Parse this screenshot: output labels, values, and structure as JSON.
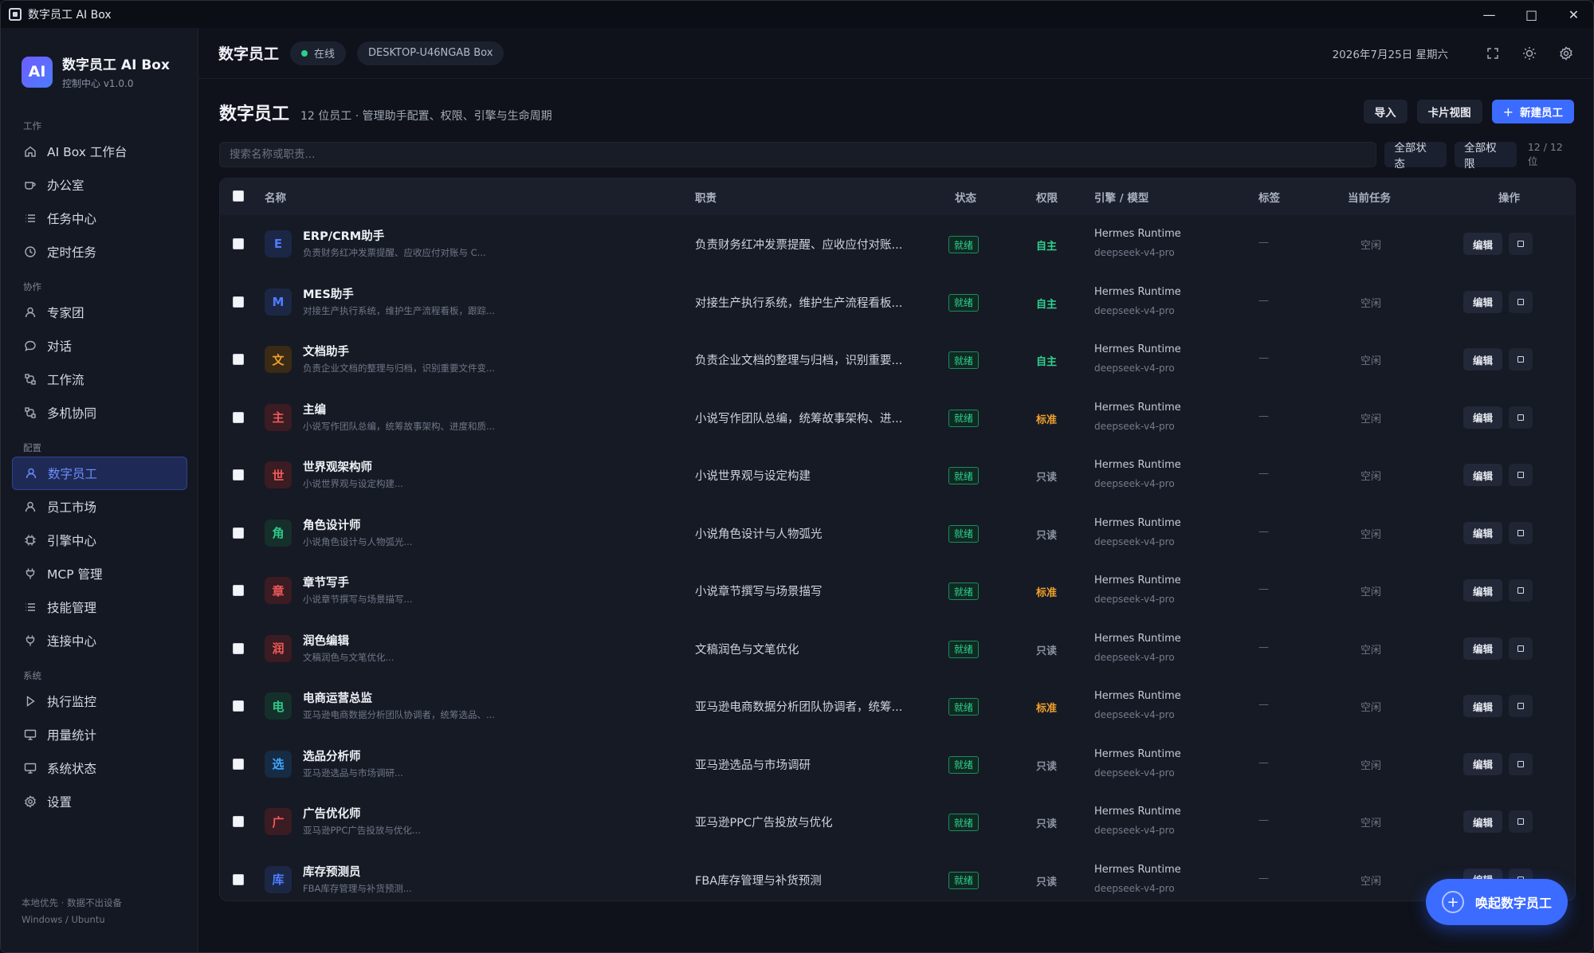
{
  "window": {
    "title": "数字员工 AI Box",
    "controls": [
      "minimize",
      "maximize",
      "close"
    ]
  },
  "brand": {
    "logo": "AI",
    "name": "数字员工 AI Box",
    "version": "控制中心 v1.0.0"
  },
  "sidebar": {
    "sections": [
      {
        "label": "工作",
        "items": [
          {
            "label": "AI Box 工作台",
            "icon": "home-icon"
          },
          {
            "label": "办公室",
            "icon": "coffee-icon"
          },
          {
            "label": "任务中心",
            "icon": "list-icon"
          },
          {
            "label": "定时任务",
            "icon": "clock-icon"
          }
        ]
      },
      {
        "label": "协作",
        "items": [
          {
            "label": "专家团",
            "icon": "user-icon"
          },
          {
            "label": "对话",
            "icon": "chat-icon"
          },
          {
            "label": "工作流",
            "icon": "workflow-icon"
          },
          {
            "label": "多机协同",
            "icon": "workflow-icon"
          }
        ]
      },
      {
        "label": "配置",
        "items": [
          {
            "label": "数字员工",
            "icon": "user-icon",
            "active": true
          },
          {
            "label": "员工市场",
            "icon": "user-icon"
          },
          {
            "label": "引擎中心",
            "icon": "cpu-icon"
          },
          {
            "label": "MCP 管理",
            "icon": "plug-icon"
          },
          {
            "label": "技能管理",
            "icon": "list-icon"
          },
          {
            "label": "连接中心",
            "icon": "plug-icon"
          }
        ]
      },
      {
        "label": "系统",
        "items": [
          {
            "label": "执行监控",
            "icon": "play-icon"
          },
          {
            "label": "用量统计",
            "icon": "monitor-icon"
          },
          {
            "label": "系统状态",
            "icon": "monitor-icon"
          },
          {
            "label": "设置",
            "icon": "gear-icon"
          }
        ]
      }
    ],
    "footer": [
      "本地优先 · 数据不出设备",
      "Windows / Ubuntu"
    ]
  },
  "topbar": {
    "title": "数字员工",
    "status": "在线",
    "device": "DESKTOP-U46NGAB Box",
    "date": "2026年7月25日 星期六"
  },
  "page": {
    "heading": "数字员工",
    "subtitle": "12 位员工 · 管理助手配置、权限、引擎与生命周期",
    "import_label": "导入",
    "card_view_label": "卡片视图",
    "new_label": "新建员工"
  },
  "filter": {
    "search_placeholder": "搜索名称或职责...",
    "status_filter": "全部状态",
    "perm_filter": "全部权限",
    "count": "12 / 12 位"
  },
  "table": {
    "columns": [
      "名称",
      "职责",
      "状态",
      "权限",
      "引擎 / 模型",
      "标签",
      "当前任务",
      "操作"
    ],
    "rows": [
      {
        "avatar": "E",
        "avatar_color": "#4f7cff",
        "avatar_bg": "#1c2746",
        "name": "ERP/CRM助手",
        "desc": "负责财务红冲发票提醒、应收应付对账与 C...",
        "duty": "负责财务红冲发票提醒、应收应付对账...",
        "status": "就绪",
        "perm": "自主",
        "perm_color": "#2fd18f",
        "engine": "Hermes Runtime",
        "model": "deepseek-v4-pro",
        "tag": "—",
        "task": "空闲",
        "edit": "编辑"
      },
      {
        "avatar": "M",
        "avatar_color": "#4f7cff",
        "avatar_bg": "#1c2746",
        "name": "MES助手",
        "desc": "对接生产执行系统，维护生产流程看板，跟踪...",
        "duty": "对接生产执行系统，维护生产流程看板...",
        "status": "就绪",
        "perm": "自主",
        "perm_color": "#2fd18f",
        "engine": "Hermes Runtime",
        "model": "deepseek-v4-pro",
        "tag": "—",
        "task": "空闲",
        "edit": "编辑"
      },
      {
        "avatar": "文",
        "avatar_color": "#f0a12c",
        "avatar_bg": "#3a2a16",
        "name": "文档助手",
        "desc": "负责企业文档的整理与归档，识别重要文件变...",
        "duty": "负责企业文档的整理与归档，识别重要...",
        "status": "就绪",
        "perm": "自主",
        "perm_color": "#2fd18f",
        "engine": "Hermes Runtime",
        "model": "deepseek-v4-pro",
        "tag": "—",
        "task": "空闲",
        "edit": "编辑"
      },
      {
        "avatar": "主",
        "avatar_color": "#f05a5a",
        "avatar_bg": "#3a1c22",
        "name": "主编",
        "desc": "小说写作团队总编，统筹故事架构、进度和质...",
        "duty": "小说写作团队总编，统筹故事架构、进...",
        "status": "就绪",
        "perm": "标准",
        "perm_color": "#f0a12c",
        "engine": "Hermes Runtime",
        "model": "deepseek-v4-pro",
        "tag": "—",
        "task": "空闲",
        "edit": "编辑"
      },
      {
        "avatar": "世",
        "avatar_color": "#f05a5a",
        "avatar_bg": "#3a1c22",
        "name": "世界观架构师",
        "desc": "小说世界观与设定构建...",
        "duty": "小说世界观与设定构建",
        "status": "就绪",
        "perm": "只读",
        "perm_color": "#8a91a0",
        "engine": "Hermes Runtime",
        "model": "deepseek-v4-pro",
        "tag": "—",
        "task": "空闲",
        "edit": "编辑"
      },
      {
        "avatar": "角",
        "avatar_color": "#2fc98a",
        "avatar_bg": "#15302a",
        "name": "角色设计师",
        "desc": "小说角色设计与人物弧光...",
        "duty": "小说角色设计与人物弧光",
        "status": "就绪",
        "perm": "只读",
        "perm_color": "#8a91a0",
        "engine": "Hermes Runtime",
        "model": "deepseek-v4-pro",
        "tag": "—",
        "task": "空闲",
        "edit": "编辑"
      },
      {
        "avatar": "章",
        "avatar_color": "#f05a5a",
        "avatar_bg": "#3a1c22",
        "name": "章节写手",
        "desc": "小说章节撰写与场景描写...",
        "duty": "小说章节撰写与场景描写",
        "status": "就绪",
        "perm": "标准",
        "perm_color": "#f0a12c",
        "engine": "Hermes Runtime",
        "model": "deepseek-v4-pro",
        "tag": "—",
        "task": "空闲",
        "edit": "编辑"
      },
      {
        "avatar": "润",
        "avatar_color": "#f05a5a",
        "avatar_bg": "#3a1c22",
        "name": "润色编辑",
        "desc": "文稿润色与文笔优化...",
        "duty": "文稿润色与文笔优化",
        "status": "就绪",
        "perm": "只读",
        "perm_color": "#8a91a0",
        "engine": "Hermes Runtime",
        "model": "deepseek-v4-pro",
        "tag": "—",
        "task": "空闲",
        "edit": "编辑"
      },
      {
        "avatar": "电",
        "avatar_color": "#2fc98a",
        "avatar_bg": "#15302a",
        "name": "电商运营总监",
        "desc": "亚马逊电商数据分析团队协调者，统筹选品、...",
        "duty": "亚马逊电商数据分析团队协调者，统筹...",
        "status": "就绪",
        "perm": "标准",
        "perm_color": "#f0a12c",
        "engine": "Hermes Runtime",
        "model": "deepseek-v4-pro",
        "tag": "—",
        "task": "空闲",
        "edit": "编辑"
      },
      {
        "avatar": "选",
        "avatar_color": "#3fa7ff",
        "avatar_bg": "#162b44",
        "name": "选品分析师",
        "desc": "亚马逊选品与市场调研...",
        "duty": "亚马逊选品与市场调研",
        "status": "就绪",
        "perm": "只读",
        "perm_color": "#8a91a0",
        "engine": "Hermes Runtime",
        "model": "deepseek-v4-pro",
        "tag": "—",
        "task": "空闲",
        "edit": "编辑"
      },
      {
        "avatar": "广",
        "avatar_color": "#f05a5a",
        "avatar_bg": "#3a1c22",
        "name": "广告优化师",
        "desc": "亚马逊PPC广告投放与优化...",
        "duty": "亚马逊PPC广告投放与优化",
        "status": "就绪",
        "perm": "只读",
        "perm_color": "#8a91a0",
        "engine": "Hermes Runtime",
        "model": "deepseek-v4-pro",
        "tag": "—",
        "task": "空闲",
        "edit": "编辑"
      },
      {
        "avatar": "库",
        "avatar_color": "#4f7cff",
        "avatar_bg": "#1c2746",
        "name": "库存预测员",
        "desc": "FBA库存管理与补货预测...",
        "duty": "FBA库存管理与补货预测",
        "status": "就绪",
        "perm": "只读",
        "perm_color": "#8a91a0",
        "engine": "Hermes Runtime",
        "model": "deepseek-v4-pro",
        "tag": "—",
        "task": "空闲",
        "edit": "编辑"
      }
    ]
  },
  "fab": {
    "label": "唤起数字员工"
  }
}
